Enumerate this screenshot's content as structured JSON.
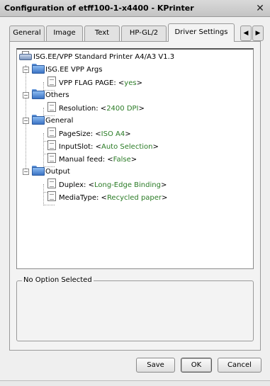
{
  "window": {
    "title": "Configuration of etff100-1-x4400 - KPrinter",
    "close_glyph": "✕"
  },
  "tabs": [
    {
      "label": "General",
      "active": false
    },
    {
      "label": "Image",
      "active": false
    },
    {
      "label": "Text",
      "active": false
    },
    {
      "label": "HP-GL/2",
      "active": false
    },
    {
      "label": "Driver Settings",
      "active": true
    }
  ],
  "tab_scroll": {
    "left": "◀",
    "right": "▶"
  },
  "tree": {
    "root": {
      "label": "ISG.EE/VPP Standard Printer A4/A3 V1.3",
      "icon": "printer-icon"
    },
    "groups": [
      {
        "label": "ISG.EE VPP Args",
        "expander": "−",
        "options": [
          {
            "name": "VPP FLAG PAGE: <",
            "value": "yes",
            "close": ">"
          }
        ]
      },
      {
        "label": "Others",
        "expander": "−",
        "options": [
          {
            "name": "Resolution: <",
            "value": "2400 DPI",
            "close": ">"
          }
        ]
      },
      {
        "label": "General",
        "expander": "−",
        "options": [
          {
            "name": "PageSize: <",
            "value": "ISO A4",
            "close": ">"
          },
          {
            "name": "InputSlot: <",
            "value": "Auto Selection",
            "close": ">"
          },
          {
            "name": "Manual feed: <",
            "value": "False",
            "close": ">"
          }
        ]
      },
      {
        "label": "Output",
        "expander": "−",
        "options": [
          {
            "name": "Duplex: <",
            "value": "Long-Edge Binding",
            "close": ">"
          },
          {
            "name": "MediaType: <",
            "value": "Recycled paper",
            "close": ">"
          }
        ]
      }
    ]
  },
  "option_box": {
    "legend": "No Option Selected"
  },
  "buttons": {
    "save": "Save",
    "ok": "OK",
    "cancel": "Cancel"
  },
  "colors": {
    "value_text": "#2a7b25",
    "folder": "#3c73c4"
  }
}
